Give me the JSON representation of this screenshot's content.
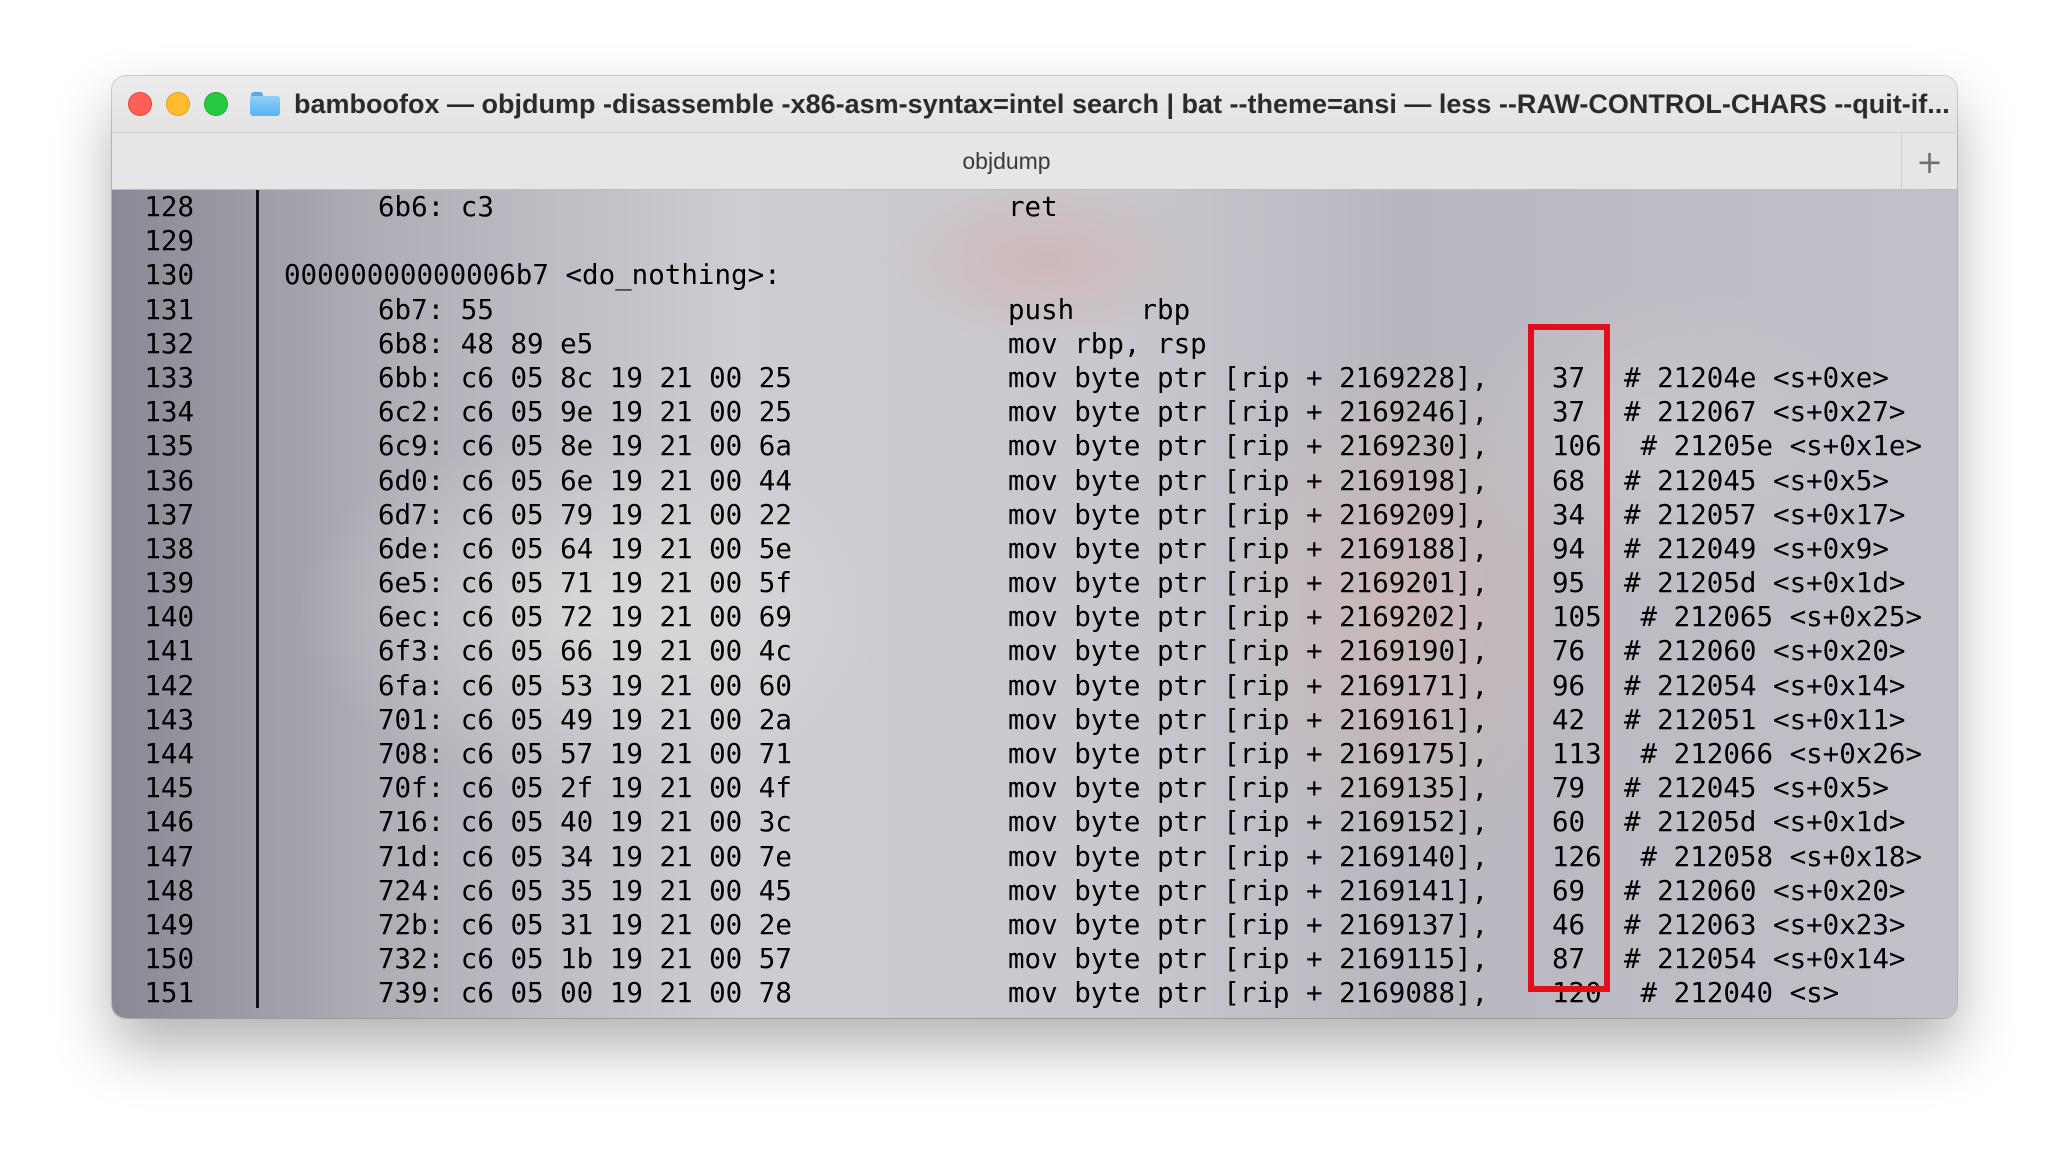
{
  "window": {
    "title": "bamboofox — objdump -disassemble -x86-asm-syntax=intel search | bat --theme=ansi — less --RAW-CONTROL-CHARS --quit-if...",
    "tab_label": "objdump",
    "new_tab_label": "+",
    "icons": {
      "close": "close-icon",
      "minimize": "minimize-icon",
      "maximize": "maximize-icon",
      "folder": "folder-icon"
    },
    "colors": {
      "close": "#fe5f57",
      "minimize": "#febc2e",
      "maximize": "#28c840",
      "highlight_box": "#e0101a"
    }
  },
  "terminal": {
    "lines": [
      {
        "num": "128",
        "addr": "6b6: c3",
        "asm": "ret",
        "val": "",
        "cmt": ""
      },
      {
        "num": "129",
        "addr": "",
        "asm": "",
        "val": "",
        "cmt": ""
      },
      {
        "num": "130",
        "label": "00000000000006b7 <do_nothing>:",
        "addr": "",
        "asm": "",
        "val": "",
        "cmt": ""
      },
      {
        "num": "131",
        "addr": "6b7: 55",
        "asm": "push    rbp",
        "val": "",
        "cmt": ""
      },
      {
        "num": "132",
        "addr": "6b8: 48 89 e5",
        "asm": "mov rbp, rsp",
        "val": "",
        "cmt": ""
      },
      {
        "num": "133",
        "addr": "6bb: c6 05 8c 19 21 00 25",
        "asm": "mov byte ptr [rip + 2169228],",
        "val": "37",
        "cmt": "# 21204e <s+0xe>"
      },
      {
        "num": "134",
        "addr": "6c2: c6 05 9e 19 21 00 25",
        "asm": "mov byte ptr [rip + 2169246],",
        "val": "37",
        "cmt": "# 212067 <s+0x27>"
      },
      {
        "num": "135",
        "addr": "6c9: c6 05 8e 19 21 00 6a",
        "asm": "mov byte ptr [rip + 2169230],",
        "val": "106",
        "cmt": " # 21205e <s+0x1e>"
      },
      {
        "num": "136",
        "addr": "6d0: c6 05 6e 19 21 00 44",
        "asm": "mov byte ptr [rip + 2169198],",
        "val": "68",
        "cmt": "# 212045 <s+0x5>"
      },
      {
        "num": "137",
        "addr": "6d7: c6 05 79 19 21 00 22",
        "asm": "mov byte ptr [rip + 2169209],",
        "val": "34",
        "cmt": "# 212057 <s+0x17>"
      },
      {
        "num": "138",
        "addr": "6de: c6 05 64 19 21 00 5e",
        "asm": "mov byte ptr [rip + 2169188],",
        "val": "94",
        "cmt": "# 212049 <s+0x9>"
      },
      {
        "num": "139",
        "addr": "6e5: c6 05 71 19 21 00 5f",
        "asm": "mov byte ptr [rip + 2169201],",
        "val": "95",
        "cmt": "# 21205d <s+0x1d>"
      },
      {
        "num": "140",
        "addr": "6ec: c6 05 72 19 21 00 69",
        "asm": "mov byte ptr [rip + 2169202],",
        "val": "105",
        "cmt": " # 212065 <s+0x25>"
      },
      {
        "num": "141",
        "addr": "6f3: c6 05 66 19 21 00 4c",
        "asm": "mov byte ptr [rip + 2169190],",
        "val": "76",
        "cmt": "# 212060 <s+0x20>"
      },
      {
        "num": "142",
        "addr": "6fa: c6 05 53 19 21 00 60",
        "asm": "mov byte ptr [rip + 2169171],",
        "val": "96",
        "cmt": "# 212054 <s+0x14>"
      },
      {
        "num": "143",
        "addr": "701: c6 05 49 19 21 00 2a",
        "asm": "mov byte ptr [rip + 2169161],",
        "val": "42",
        "cmt": "# 212051 <s+0x11>"
      },
      {
        "num": "144",
        "addr": "708: c6 05 57 19 21 00 71",
        "asm": "mov byte ptr [rip + 2169175],",
        "val": "113",
        "cmt": " # 212066 <s+0x26>"
      },
      {
        "num": "145",
        "addr": "70f: c6 05 2f 19 21 00 4f",
        "asm": "mov byte ptr [rip + 2169135],",
        "val": "79",
        "cmt": "# 212045 <s+0x5>"
      },
      {
        "num": "146",
        "addr": "716: c6 05 40 19 21 00 3c",
        "asm": "mov byte ptr [rip + 2169152],",
        "val": "60",
        "cmt": "# 21205d <s+0x1d>"
      },
      {
        "num": "147",
        "addr": "71d: c6 05 34 19 21 00 7e",
        "asm": "mov byte ptr [rip + 2169140],",
        "val": "126",
        "cmt": " # 212058 <s+0x18>"
      },
      {
        "num": "148",
        "addr": "724: c6 05 35 19 21 00 45",
        "asm": "mov byte ptr [rip + 2169141],",
        "val": "69",
        "cmt": "# 212060 <s+0x20>"
      },
      {
        "num": "149",
        "addr": "72b: c6 05 31 19 21 00 2e",
        "asm": "mov byte ptr [rip + 2169137],",
        "val": "46",
        "cmt": "# 212063 <s+0x23>"
      },
      {
        "num": "150",
        "addr": "732: c6 05 1b 19 21 00 57",
        "asm": "mov byte ptr [rip + 2169115],",
        "val": "87",
        "cmt": "# 212054 <s+0x14>"
      },
      {
        "num": "151",
        "addr": "739: c6 05 00 19 21 00 78",
        "asm": "mov byte ptr [rip + 2169088],",
        "val": "120",
        "cmt": " # 212040 <s>"
      }
    ]
  }
}
